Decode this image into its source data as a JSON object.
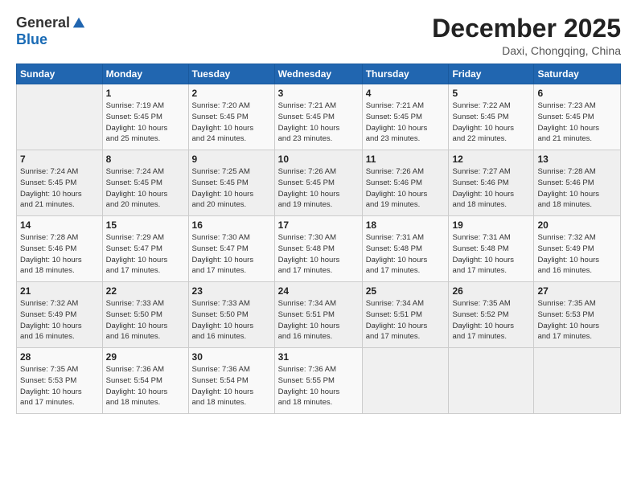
{
  "logo": {
    "general": "General",
    "blue": "Blue"
  },
  "title": "December 2025",
  "subtitle": "Daxi, Chongqing, China",
  "weekdays": [
    "Sunday",
    "Monday",
    "Tuesday",
    "Wednesday",
    "Thursday",
    "Friday",
    "Saturday"
  ],
  "weeks": [
    [
      {
        "num": "",
        "info": ""
      },
      {
        "num": "1",
        "info": "Sunrise: 7:19 AM\nSunset: 5:45 PM\nDaylight: 10 hours\nand 25 minutes."
      },
      {
        "num": "2",
        "info": "Sunrise: 7:20 AM\nSunset: 5:45 PM\nDaylight: 10 hours\nand 24 minutes."
      },
      {
        "num": "3",
        "info": "Sunrise: 7:21 AM\nSunset: 5:45 PM\nDaylight: 10 hours\nand 23 minutes."
      },
      {
        "num": "4",
        "info": "Sunrise: 7:21 AM\nSunset: 5:45 PM\nDaylight: 10 hours\nand 23 minutes."
      },
      {
        "num": "5",
        "info": "Sunrise: 7:22 AM\nSunset: 5:45 PM\nDaylight: 10 hours\nand 22 minutes."
      },
      {
        "num": "6",
        "info": "Sunrise: 7:23 AM\nSunset: 5:45 PM\nDaylight: 10 hours\nand 21 minutes."
      }
    ],
    [
      {
        "num": "7",
        "info": "Sunrise: 7:24 AM\nSunset: 5:45 PM\nDaylight: 10 hours\nand 21 minutes."
      },
      {
        "num": "8",
        "info": "Sunrise: 7:24 AM\nSunset: 5:45 PM\nDaylight: 10 hours\nand 20 minutes."
      },
      {
        "num": "9",
        "info": "Sunrise: 7:25 AM\nSunset: 5:45 PM\nDaylight: 10 hours\nand 20 minutes."
      },
      {
        "num": "10",
        "info": "Sunrise: 7:26 AM\nSunset: 5:45 PM\nDaylight: 10 hours\nand 19 minutes."
      },
      {
        "num": "11",
        "info": "Sunrise: 7:26 AM\nSunset: 5:46 PM\nDaylight: 10 hours\nand 19 minutes."
      },
      {
        "num": "12",
        "info": "Sunrise: 7:27 AM\nSunset: 5:46 PM\nDaylight: 10 hours\nand 18 minutes."
      },
      {
        "num": "13",
        "info": "Sunrise: 7:28 AM\nSunset: 5:46 PM\nDaylight: 10 hours\nand 18 minutes."
      }
    ],
    [
      {
        "num": "14",
        "info": "Sunrise: 7:28 AM\nSunset: 5:46 PM\nDaylight: 10 hours\nand 18 minutes."
      },
      {
        "num": "15",
        "info": "Sunrise: 7:29 AM\nSunset: 5:47 PM\nDaylight: 10 hours\nand 17 minutes."
      },
      {
        "num": "16",
        "info": "Sunrise: 7:30 AM\nSunset: 5:47 PM\nDaylight: 10 hours\nand 17 minutes."
      },
      {
        "num": "17",
        "info": "Sunrise: 7:30 AM\nSunset: 5:48 PM\nDaylight: 10 hours\nand 17 minutes."
      },
      {
        "num": "18",
        "info": "Sunrise: 7:31 AM\nSunset: 5:48 PM\nDaylight: 10 hours\nand 17 minutes."
      },
      {
        "num": "19",
        "info": "Sunrise: 7:31 AM\nSunset: 5:48 PM\nDaylight: 10 hours\nand 17 minutes."
      },
      {
        "num": "20",
        "info": "Sunrise: 7:32 AM\nSunset: 5:49 PM\nDaylight: 10 hours\nand 16 minutes."
      }
    ],
    [
      {
        "num": "21",
        "info": "Sunrise: 7:32 AM\nSunset: 5:49 PM\nDaylight: 10 hours\nand 16 minutes."
      },
      {
        "num": "22",
        "info": "Sunrise: 7:33 AM\nSunset: 5:50 PM\nDaylight: 10 hours\nand 16 minutes."
      },
      {
        "num": "23",
        "info": "Sunrise: 7:33 AM\nSunset: 5:50 PM\nDaylight: 10 hours\nand 16 minutes."
      },
      {
        "num": "24",
        "info": "Sunrise: 7:34 AM\nSunset: 5:51 PM\nDaylight: 10 hours\nand 16 minutes."
      },
      {
        "num": "25",
        "info": "Sunrise: 7:34 AM\nSunset: 5:51 PM\nDaylight: 10 hours\nand 17 minutes."
      },
      {
        "num": "26",
        "info": "Sunrise: 7:35 AM\nSunset: 5:52 PM\nDaylight: 10 hours\nand 17 minutes."
      },
      {
        "num": "27",
        "info": "Sunrise: 7:35 AM\nSunset: 5:53 PM\nDaylight: 10 hours\nand 17 minutes."
      }
    ],
    [
      {
        "num": "28",
        "info": "Sunrise: 7:35 AM\nSunset: 5:53 PM\nDaylight: 10 hours\nand 17 minutes."
      },
      {
        "num": "29",
        "info": "Sunrise: 7:36 AM\nSunset: 5:54 PM\nDaylight: 10 hours\nand 18 minutes."
      },
      {
        "num": "30",
        "info": "Sunrise: 7:36 AM\nSunset: 5:54 PM\nDaylight: 10 hours\nand 18 minutes."
      },
      {
        "num": "31",
        "info": "Sunrise: 7:36 AM\nSunset: 5:55 PM\nDaylight: 10 hours\nand 18 minutes."
      },
      {
        "num": "",
        "info": ""
      },
      {
        "num": "",
        "info": ""
      },
      {
        "num": "",
        "info": ""
      }
    ]
  ]
}
